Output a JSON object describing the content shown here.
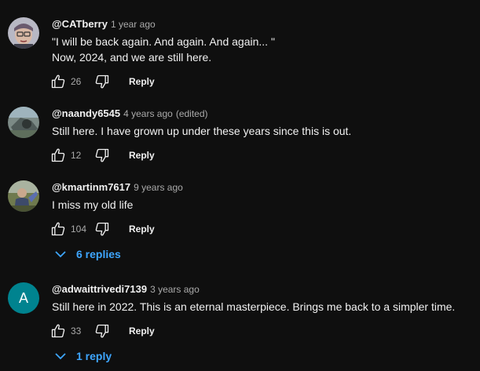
{
  "comments": [
    {
      "author": "@CATberry",
      "time": "1 year ago",
      "edited": "",
      "text_lines": [
        "\"I will be back  again. And again. And again... \"",
        "Now, 2024, and we are still here."
      ],
      "likes": "26",
      "reply_label": "Reply",
      "avatar_icon": "cartoon-face-avatar"
    },
    {
      "author": "@naandy6545",
      "time": "4 years ago",
      "edited": "(edited)",
      "text_lines": [
        "Still here. I have grown up under these years since this is out."
      ],
      "likes": "12",
      "reply_label": "Reply",
      "avatar_icon": "photo-avatar"
    },
    {
      "author": "@kmartinm7617",
      "time": "9 years ago",
      "edited": "",
      "text_lines": [
        "I miss my old life"
      ],
      "likes": "104",
      "reply_label": "Reply",
      "avatar_icon": "photo-avatar",
      "replies": "6 replies"
    },
    {
      "author": "@adwaittrivedi7139",
      "time": "3 years ago",
      "edited": "",
      "text_lines": [
        "Still here in 2022. This is an eternal masterpiece. Brings me back to a simpler time."
      ],
      "likes": "33",
      "reply_label": "Reply",
      "avatar_letter": "A",
      "avatar_color": "#00838f",
      "replies": "1 reply"
    }
  ],
  "colors": {
    "background": "#0f0f0f",
    "text": "#f1f1f1",
    "secondary": "#aaaaaa",
    "link": "#3ea6ff"
  }
}
